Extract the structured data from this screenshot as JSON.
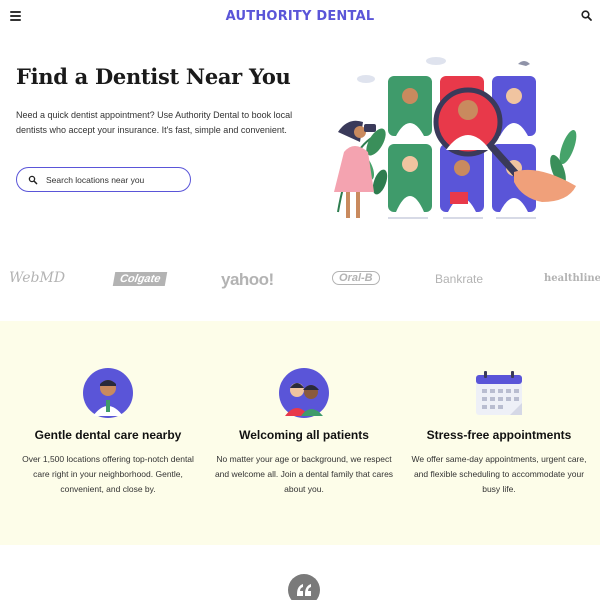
{
  "header": {
    "brand_part1": "AUTHORITY",
    "brand_part2": "DENTAL",
    "menu_icon": "hamburger-menu-icon",
    "search_icon": "search-icon"
  },
  "hero": {
    "title": "Find a Dentist Near You",
    "description": "Need a quick dentist appointment? Use Authority Dental to book local dentists who accept your insurance. It's fast, simple and convenient.",
    "search_placeholder": "Search locations near you"
  },
  "partners": [
    "WebMD",
    "Colgate",
    "yahoo!",
    "Oral-B",
    "Bankrate",
    "healthline"
  ],
  "features": [
    {
      "title": "Gentle dental care nearby",
      "text": "Over 1,500 locations offering top-notch dental care right in your neighborhood. Gentle, convenient, and close by.",
      "icon": "dentist-avatar-icon"
    },
    {
      "title": "Welcoming all patients",
      "text": "No matter your age or background, we respect and welcome all. Join a dental family that cares about you.",
      "icon": "patients-avatar-icon"
    },
    {
      "title": "Stress-free appointments",
      "text": "We offer same-day appointments, urgent care, and flexible scheduling to accommodate your busy life.",
      "icon": "calendar-icon"
    }
  ],
  "colors": {
    "accent": "#5a55d8",
    "features_bg": "#fdfde9",
    "magnifier": "#e8394a"
  }
}
